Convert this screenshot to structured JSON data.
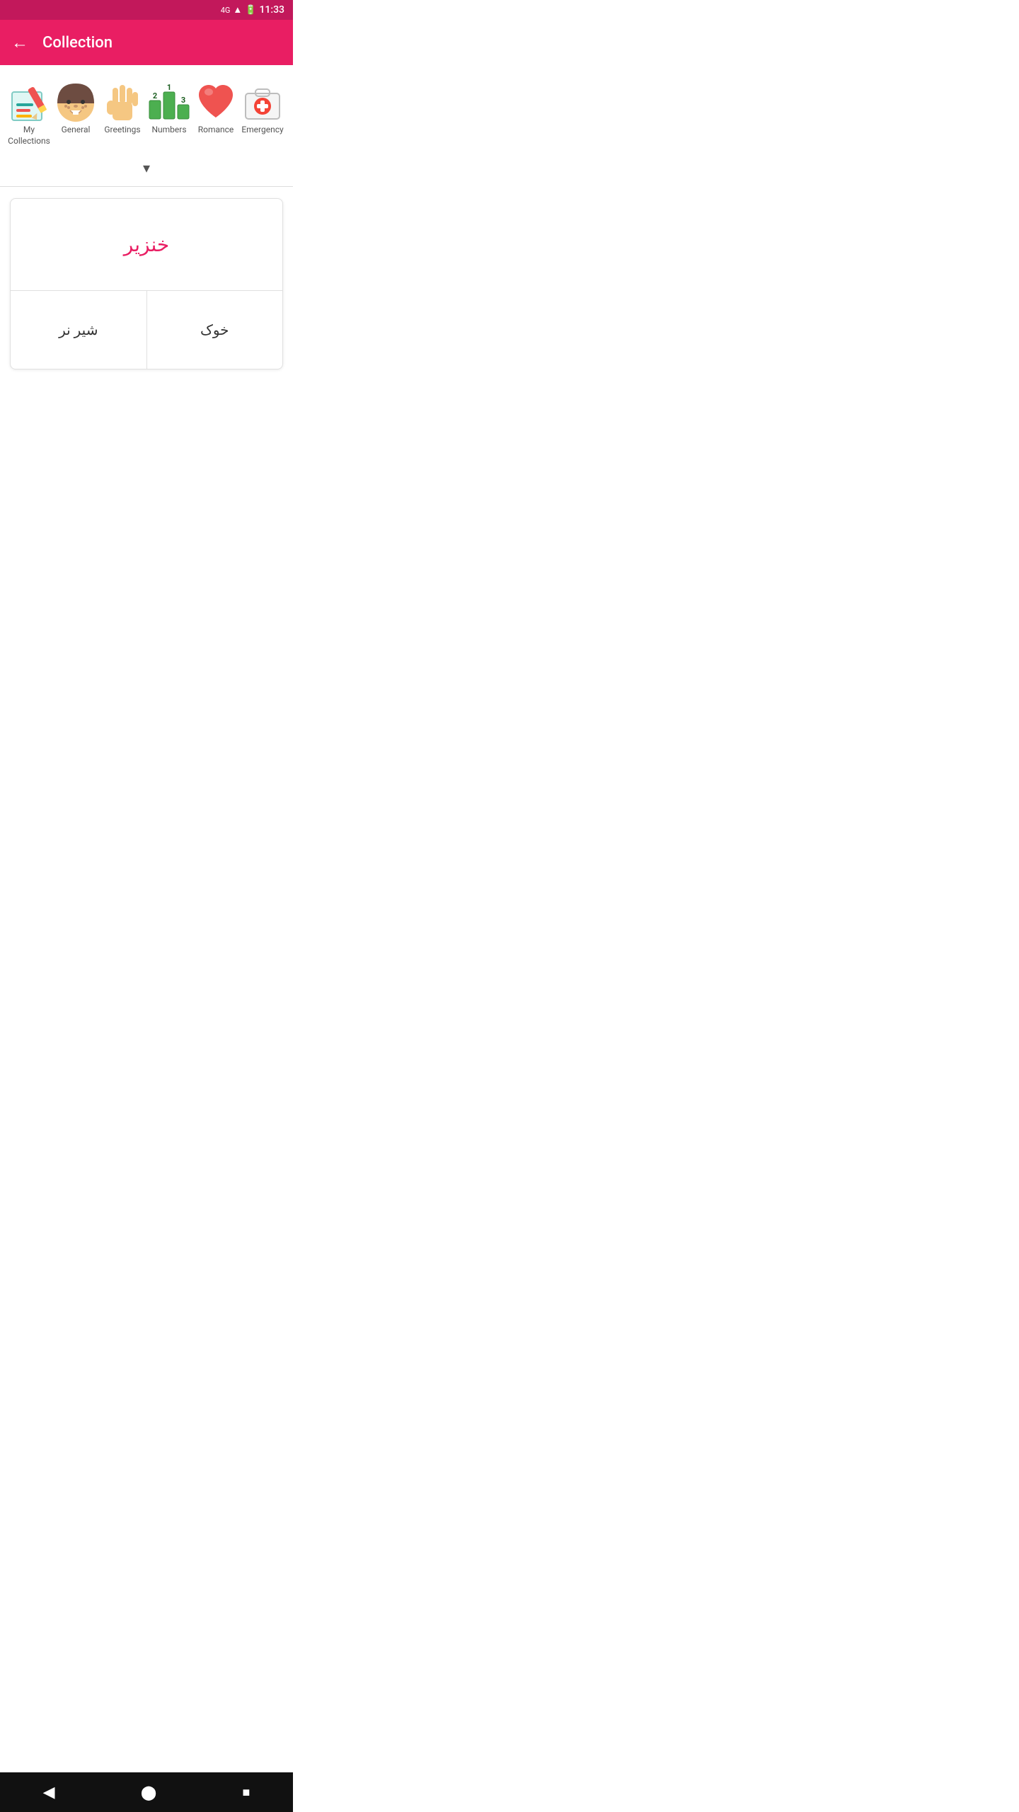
{
  "statusBar": {
    "network": "4G",
    "time": "11:33"
  },
  "header": {
    "backLabel": "←",
    "title": "Collection"
  },
  "categories": [
    {
      "id": "my-collections",
      "label": "My Collections",
      "icon": "my-collections"
    },
    {
      "id": "general",
      "label": "General",
      "icon": "general"
    },
    {
      "id": "greetings",
      "label": "Greetings",
      "icon": "greetings"
    },
    {
      "id": "numbers",
      "label": "Numbers",
      "icon": "numbers"
    },
    {
      "id": "romance",
      "label": "Romance",
      "icon": "romance"
    },
    {
      "id": "emergency",
      "label": "Emergency",
      "icon": "emergency"
    }
  ],
  "chevron": "▾",
  "quiz": {
    "question": "خنزير",
    "options": [
      {
        "id": "option-left",
        "text": "شیر نر"
      },
      {
        "id": "option-right",
        "text": "خوک"
      }
    ]
  },
  "navBar": {
    "back": "◀",
    "home": "⬤",
    "recent": "■"
  }
}
